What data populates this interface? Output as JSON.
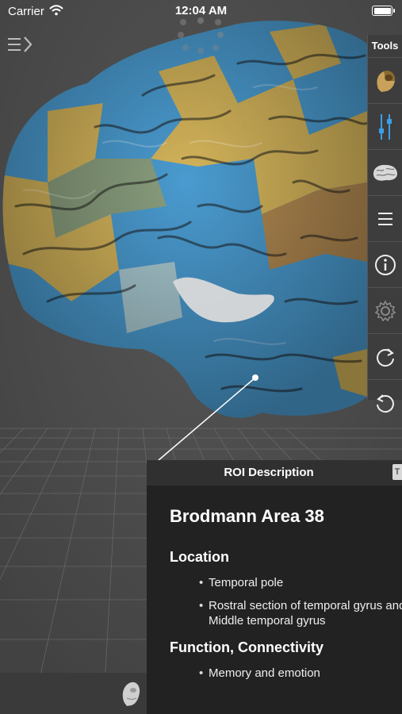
{
  "status_bar": {
    "carrier": "Carrier",
    "time": "12:04 AM",
    "battery_level": 1.0
  },
  "header": {
    "menu_icon": "sidebar-toggle-icon",
    "loading_icon": "activity-spinner-icon"
  },
  "tools": {
    "label": "Tools",
    "items": [
      {
        "name": "head-model",
        "icon": "head-model-icon"
      },
      {
        "name": "sliders",
        "icon": "sliders-icon"
      },
      {
        "name": "brain",
        "icon": "brain-icon"
      },
      {
        "name": "list",
        "icon": "list-icon"
      },
      {
        "name": "info",
        "icon": "info-icon"
      },
      {
        "name": "settings",
        "icon": "gear-icon"
      },
      {
        "name": "rotate-clockwise",
        "icon": "rotate-clockwise-icon"
      },
      {
        "name": "rotate-counterclockwise",
        "icon": "rotate-counterclockwise-icon"
      }
    ]
  },
  "roi": {
    "header": "ROI Description",
    "tab_label": "T",
    "title": "Brodmann Area 38",
    "sections": [
      {
        "heading": "Location",
        "items": [
          "Temporal pole",
          "Rostral section of temporal gyrus and Middle temporal gyrus"
        ]
      },
      {
        "heading": "Function, Connectivity",
        "items": [
          "Memory and emotion"
        ]
      }
    ]
  },
  "colors": {
    "background": "#4a4a4a",
    "brain_gold": "#d4b45a",
    "brain_blue": "#4a9bd0",
    "brain_sage": "#8a9e7e",
    "panel": "#222222",
    "accent_blue": "#3aa0e8"
  }
}
